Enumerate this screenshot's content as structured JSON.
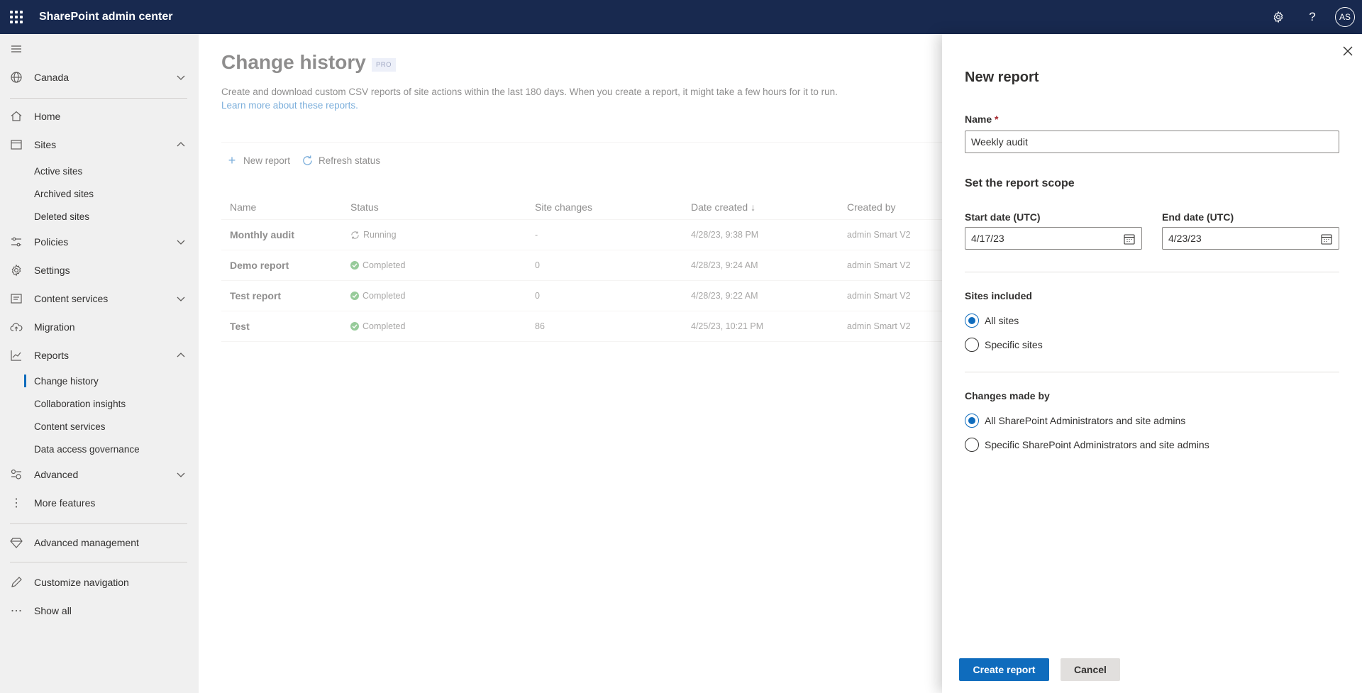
{
  "header": {
    "app_title": "SharePoint admin center",
    "avatar_initials": "AS"
  },
  "sidebar": {
    "items": [
      {
        "label": "Canada",
        "icon": "globe-icon",
        "chevron": "down"
      },
      {
        "label": "Home",
        "icon": "home-icon"
      },
      {
        "label": "Sites",
        "icon": "sites-icon",
        "chevron": "up"
      },
      {
        "label": "Policies",
        "icon": "policies-icon",
        "chevron": "down"
      },
      {
        "label": "Settings",
        "icon": "gear-icon"
      },
      {
        "label": "Content services",
        "icon": "content-services-icon",
        "chevron": "down"
      },
      {
        "label": "Migration",
        "icon": "cloud-upload-icon"
      },
      {
        "label": "Reports",
        "icon": "chart-icon",
        "chevron": "up"
      },
      {
        "label": "Advanced",
        "icon": "advanced-icon",
        "chevron": "down"
      },
      {
        "label": "More features",
        "icon": "more-vertical-icon"
      },
      {
        "label": "Advanced management",
        "icon": "diamond-icon"
      },
      {
        "label": "Customize navigation",
        "icon": "pencil-icon"
      },
      {
        "label": "Show all",
        "icon": "ellipsis-icon"
      }
    ],
    "sites_sub": [
      "Active sites",
      "Archived sites",
      "Deleted sites"
    ],
    "reports_sub": [
      "Change history",
      "Collaboration insights",
      "Content services",
      "Data access governance"
    ]
  },
  "main": {
    "title": "Change history",
    "badge": "PRO",
    "description": "Create and download custom CSV reports of site actions within the last 180 days. When you create a report, it might take a few hours for it to run.",
    "learn_more": "Learn more about these reports.",
    "commands": {
      "new_report": "New report",
      "refresh_status": "Refresh status"
    },
    "table": {
      "columns": [
        "Name",
        "Status",
        "Site changes",
        "Date created",
        "Created by"
      ],
      "sort_indicator": "↓",
      "rows": [
        {
          "name": "Monthly audit",
          "status": "Running",
          "site_changes": "-",
          "date_created": "4/28/23, 9:38 PM",
          "created_by": "admin Smart V2"
        },
        {
          "name": "Demo report",
          "status": "Completed",
          "site_changes": "0",
          "date_created": "4/28/23, 9:24 AM",
          "created_by": "admin Smart V2"
        },
        {
          "name": "Test report",
          "status": "Completed",
          "site_changes": "0",
          "date_created": "4/28/23, 9:22 AM",
          "created_by": "admin Smart V2"
        },
        {
          "name": "Test",
          "status": "Completed",
          "site_changes": "86",
          "date_created": "4/25/23, 10:21 PM",
          "created_by": "admin Smart V2"
        }
      ]
    }
  },
  "panel": {
    "title": "New report",
    "name_label": "Name",
    "required_marker": "*",
    "name_value": "Weekly audit",
    "scope_title": "Set the report scope",
    "start_label": "Start date (UTC)",
    "start_value": "4/17/23",
    "end_label": "End date (UTC)",
    "end_value": "4/23/23",
    "sites_label": "Sites included",
    "sites_options": [
      {
        "label": "All sites",
        "selected": true
      },
      {
        "label": "Specific sites",
        "selected": false
      }
    ],
    "changes_label": "Changes made by",
    "changes_options": [
      {
        "label": "All SharePoint Administrators and site admins",
        "selected": true
      },
      {
        "label": "Specific SharePoint Administrators and site admins",
        "selected": false
      }
    ],
    "create_button": "Create report",
    "cancel_button": "Cancel"
  },
  "colors": {
    "topbar": "#18294f",
    "accent": "#0f6cbd",
    "success": "#43a047",
    "sidebar_bg": "#f0f0f0"
  }
}
